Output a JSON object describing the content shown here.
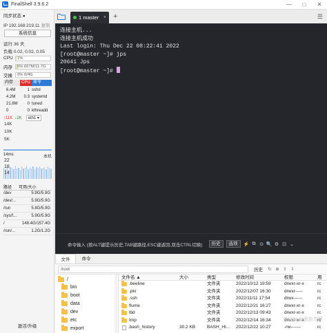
{
  "app": {
    "title": "FinalShell 3.9.6.2",
    "min": "—",
    "max": "□",
    "close": "✕"
  },
  "sidebar": {
    "sync_status": "同步状态 ●",
    "ip": "IP 192.168.219.11",
    "copy": "复制",
    "sysinfo_button": "系统信息",
    "uptime": "运行 36 天",
    "load": "负载 0.02, 0.02, 0.05",
    "meters": [
      {
        "label": "CPU",
        "text": "1%",
        "percent": 1
      },
      {
        "label": "内存",
        "text": "6%   667M/11.7G",
        "percent": 6
      },
      {
        "label": "交换",
        "text": "0%       0/4G",
        "percent": 0
      }
    ],
    "proc_headers": {
      "mem": "内存",
      "cpu": "CPU",
      "cmd": "命令"
    },
    "processes": [
      {
        "mem": "6.4M",
        "cpu": "1",
        "name": "sshd"
      },
      {
        "mem": "4.2M",
        "cpu": "0.3",
        "name": "systemd"
      },
      {
        "mem": "21.6M",
        "cpu": "0",
        "name": "tuned"
      },
      {
        "mem": "0",
        "cpu": "0",
        "name": "kthreadd"
      }
    ],
    "net": {
      "up": "↑11K",
      "down": "↓2K",
      "iface": "eth1 ▾",
      "ticks": [
        "14K",
        "10K",
        "5K"
      ]
    },
    "latency": {
      "label": "14ms",
      "host": "本机",
      "ticks": [
        "22",
        "18",
        "14"
      ],
      "bars": [
        0.62,
        0.55,
        0.7,
        0.48,
        0.66,
        0.6,
        0.52,
        0.74,
        0.58,
        0.63,
        0.5,
        0.68,
        0.57,
        0.61,
        0.72,
        0.54,
        0.65,
        0.59,
        0.69,
        0.53,
        0.64,
        0.6,
        0.71,
        0.56,
        0.62,
        0.67,
        0.55,
        0.7,
        0.6,
        0.58
      ]
    },
    "disk_headers": {
      "path": "路径",
      "size": "可用/大小"
    },
    "disks": [
      {
        "path": "/dev",
        "size": "5.9G/5.9G"
      },
      {
        "path": "/dev/...",
        "size": "5.9G/5.9G"
      },
      {
        "path": "/run",
        "size": "5.8G/5.9G"
      },
      {
        "path": "/sys/f...",
        "size": "5.9G/5.9G"
      },
      {
        "path": "/",
        "size": "148.4G/157.4G"
      },
      {
        "path": "/run/...",
        "size": "1.2G/1.2G"
      }
    ],
    "upgrade": "激活/升级"
  },
  "tabs": {
    "active": "1 master",
    "close": "×",
    "add": "+",
    "menu": "☰"
  },
  "terminal": {
    "lines": [
      "连接主机...",
      "连接主机成功",
      "Last login: Thu Dec 22 08:22:41 2022",
      "[root@master ~]# jps",
      "20641 Jps",
      "[root@master ~]# "
    ]
  },
  "cmdbar": {
    "hint": "命令输入 (按ALT键提示历史,TAB键路径,ESC键返回,双击CTRL切换)",
    "history_btn": "历史",
    "options_btn": "选项",
    "icons": [
      "⚡",
      "⧉",
      "⊙",
      "🔍",
      "⚙",
      "⊡",
      "⌄"
    ]
  },
  "filemanager": {
    "tabs": [
      "文件",
      "命令"
    ],
    "path": "/root",
    "history": "历史",
    "path_icons": [
      "↻",
      "⊕",
      "⇧",
      "⇩"
    ],
    "tree": [
      "/",
      "bin",
      "boot",
      "data",
      "dev",
      "etc",
      "export"
    ],
    "columns": {
      "name": "文件名 ▲",
      "size": "大小",
      "type": "类型",
      "time": "修改时间",
      "perm": "权限",
      "owner": "用"
    },
    "files": [
      {
        "name": ".beeline",
        "size": "",
        "type": "文件夹",
        "time": "2022/10/12 19:59",
        "perm": "drwxr-xr-x",
        "owner": "rc",
        "folder": true
      },
      {
        "name": ".pki",
        "size": "",
        "type": "文件夹",
        "time": "2022/12/07 16:30",
        "perm": "drwxr-----",
        "owner": "rc",
        "folder": true
      },
      {
        "name": ".ssh",
        "size": "",
        "type": "文件夹",
        "time": "2022/11/11 17:54",
        "perm": "drwx------",
        "owner": "rc",
        "folder": true
      },
      {
        "name": "flume",
        "size": "",
        "type": "文件夹",
        "time": "2022/12/21 16:27",
        "perm": "drwxr-xr-x",
        "owner": "rc",
        "folder": true
      },
      {
        "name": "lbd",
        "size": "",
        "type": "文件夹",
        "time": "2022/12/13 09:43",
        "perm": "drwxr-xr-x",
        "owner": "rc",
        "folder": true
      },
      {
        "name": "tmp",
        "size": "",
        "type": "文件夹",
        "time": "2022/12/14 16:34",
        "perm": "drwxr-xr-x",
        "owner": "rc",
        "folder": true
      },
      {
        "name": ".bash_history",
        "size": "30.2 KB",
        "type": "BASH_HI...",
        "time": "2022/12/22 10:27",
        "perm": "-rw-------",
        "owner": "rc",
        "folder": false
      }
    ],
    "watermark": "CSDN @爱新觉罗"
  }
}
